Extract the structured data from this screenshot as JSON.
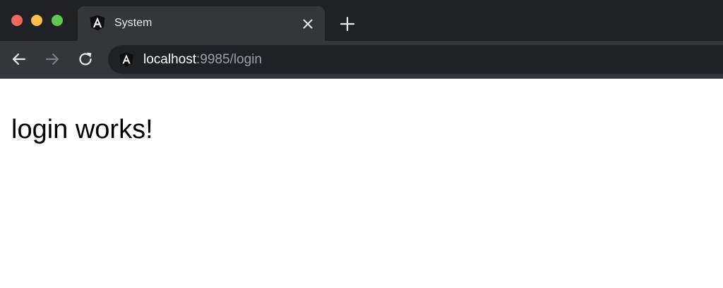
{
  "browser": {
    "tab": {
      "title": "System",
      "favicon": "angular-icon"
    },
    "new_tab_icon": "plus-icon",
    "close_tab_icon": "close-icon",
    "nav": {
      "back_icon": "arrow-left-icon",
      "forward_icon": "arrow-right-icon",
      "reload_icon": "reload-icon"
    },
    "address": {
      "host": "localhost",
      "rest": ":9985/login",
      "site_icon": "angular-icon"
    },
    "colors": {
      "tab_strip": "#202124",
      "toolbar": "#35363a",
      "active_tab": "#35363a",
      "omnibox": "#202124",
      "close_red": "#ee6a5f",
      "minimize_yellow": "#f5be4f",
      "zoom_green": "#62c654"
    }
  },
  "page": {
    "heading": "login works!"
  }
}
